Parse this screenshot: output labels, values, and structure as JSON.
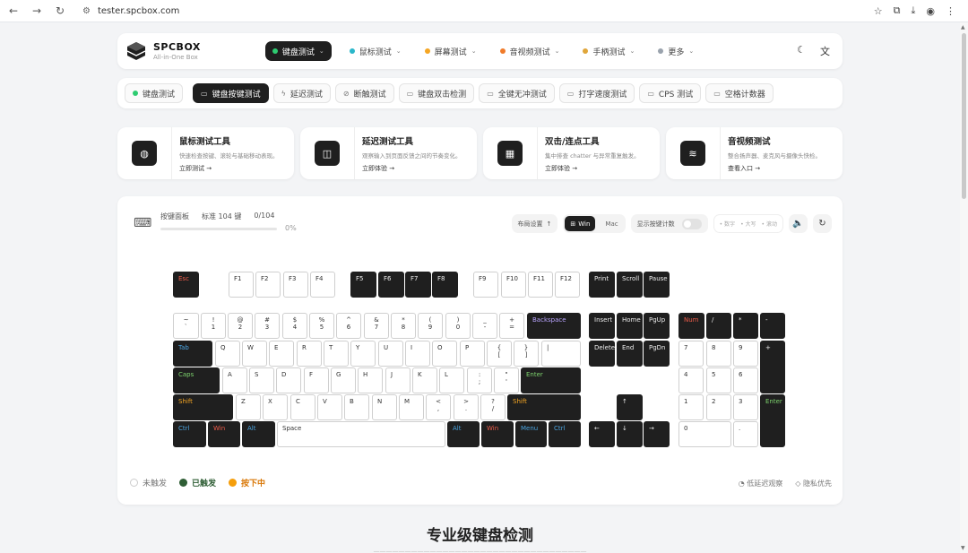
{
  "browser": {
    "url": "tester.spcbox.com",
    "back_icon": "arrow-left-icon",
    "forward_icon": "arrow-right-icon",
    "reload_icon": "reload-icon"
  },
  "header": {
    "brand": "SPCBOX",
    "tagline": "All-in-One Box",
    "nav": [
      {
        "label": "键盘测试",
        "dot": "#2ecc71",
        "active": true
      },
      {
        "label": "鼠标测试",
        "dot": "#2ab7ca",
        "active": false
      },
      {
        "label": "屏幕测试",
        "dot": "#f5a623",
        "active": false
      },
      {
        "label": "音视频测试",
        "dot": "#f07b2a",
        "active": false
      },
      {
        "label": "手柄测试",
        "dot": "#e0a63a",
        "active": false
      },
      {
        "label": "更多",
        "dot": "#9aa3ad",
        "active": false
      }
    ]
  },
  "subnav": {
    "home": "键盘测试",
    "items": [
      {
        "label": "键盘按键测试",
        "active": true,
        "icon": "⌨"
      },
      {
        "label": "延迟测试",
        "active": false,
        "icon": "⚡"
      },
      {
        "label": "断触测试",
        "active": false,
        "icon": "⊘"
      },
      {
        "label": "键盘双击检测",
        "active": false,
        "icon": "⌨"
      },
      {
        "label": "全键无冲测试",
        "active": false,
        "icon": "⌨"
      },
      {
        "label": "打字速度测试",
        "active": false,
        "icon": "⌨"
      },
      {
        "label": "CPS 测试",
        "active": false,
        "icon": "⌨"
      },
      {
        "label": "空格计数器",
        "active": false,
        "icon": "⌨"
      }
    ]
  },
  "tools": [
    {
      "title": "鼠标测试工具",
      "desc": "快速检查按键、滚轮与基础移动表现。",
      "link": "立即测试 →",
      "icon": "mouse-icon",
      "glyph": "◍"
    },
    {
      "title": "延迟测试工具",
      "desc": "观察输入到页面反馈之间的节奏变化。",
      "link": "立即体验 →",
      "icon": "camera-icon",
      "glyph": "◫"
    },
    {
      "title": "双击/连点工具",
      "desc": "集中排查 chatter 与异常重复触发。",
      "link": "立即体验 →",
      "icon": "keyboard-icon",
      "glyph": "▦"
    },
    {
      "title": "音视频测试",
      "desc": "整合扬声器、麦克风与摄像头快检。",
      "link": "查看入口 →",
      "icon": "waveform-icon",
      "glyph": "≋"
    }
  ],
  "panel": {
    "label": "按键面板",
    "layout_name": "标准 104 键",
    "count": "0/104",
    "percent": "0%",
    "progress": 0,
    "layout_btn": "布局设置",
    "os": {
      "win": "Win",
      "mac": "Mac"
    },
    "show_count": "显示按键计数",
    "lights": [
      "数字",
      "大写",
      "滚动"
    ]
  },
  "legend": {
    "untouched": "未触发",
    "triggered": "已触发",
    "pressing": "按下中",
    "colors": {
      "triggered": "#2f5e35",
      "pressing": "#f59e0b"
    }
  },
  "footer_right": {
    "latency": "低延迟观察",
    "privacy": "隐私优先"
  },
  "headline": "专业级键盘检测",
  "subline": "——————————————————————————————————"
}
